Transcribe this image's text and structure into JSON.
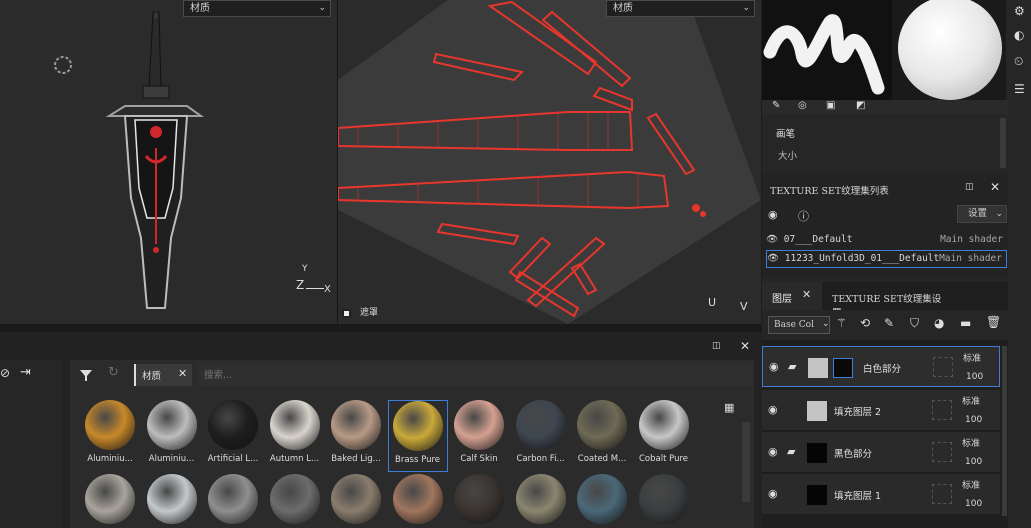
{
  "viewport3d": {
    "dropdown_label": "材质",
    "axis_labels": {
      "y": "Y",
      "z": "Z",
      "x": "X"
    }
  },
  "viewport2d": {
    "dropdown_label": "材质",
    "mask_label": "遮罩",
    "axis_labels": {
      "u": "U",
      "v": "V"
    }
  },
  "brush_panel": {
    "section_label": "画笔",
    "size_label": "大小"
  },
  "texture_set_list": {
    "title": "TEXTURE SET纹理集列表",
    "settings_label": "设置",
    "rows": [
      {
        "name": "07___Default",
        "shader": "Main shader"
      },
      {
        "name": "11233_Unfold3D_01___Default",
        "shader": "Main shader"
      }
    ]
  },
  "layers_panel": {
    "tab_layers": "图层",
    "tab_settings": "TEXTURE SET纹理集设置",
    "channel_select": "Base Col",
    "layers": [
      {
        "name": "白色部分",
        "blend": "标准",
        "opacity": "100"
      },
      {
        "name": "填充图层 2",
        "blend": "标准",
        "opacity": "100"
      },
      {
        "name": "黑色部分",
        "blend": "标准",
        "opacity": "100"
      },
      {
        "name": "填充图层 1",
        "blend": "标准",
        "opacity": "100"
      }
    ]
  },
  "shelf": {
    "filter_tag": "材质",
    "search_placeholder": "搜索...",
    "materials_row1": [
      {
        "label": "Aluminiu...",
        "color": "#c8882a"
      },
      {
        "label": "Aluminiu...",
        "color": "#bdbdbd"
      },
      {
        "label": "Artificial L...",
        "color": "#1e1e1e"
      },
      {
        "label": "Autumn L...",
        "color": "#d8d3cc"
      },
      {
        "label": "Baked Lig...",
        "color": "#b79a86"
      },
      {
        "label": "Brass Pure",
        "color": "#c9a93a"
      },
      {
        "label": "Calf Skin",
        "color": "#d4a191"
      },
      {
        "label": "Carbon Fi...",
        "color": "#3e4650"
      },
      {
        "label": "Coated M...",
        "color": "#6e6a55"
      },
      {
        "label": "Cobalt Pure",
        "color": "#c7c7c7"
      }
    ],
    "materials_row2_colors": [
      "#a9a49c",
      "#c3c8cc",
      "#8f8f8f",
      "#6c6c6c",
      "#8a7d6e",
      "#a0765e",
      "#3a3430",
      "#8b8670",
      "#4b6878",
      "#3b3e40"
    ]
  },
  "colors": {
    "accent_blue": "#3d7fd6",
    "uv_red": "#e8362c"
  }
}
